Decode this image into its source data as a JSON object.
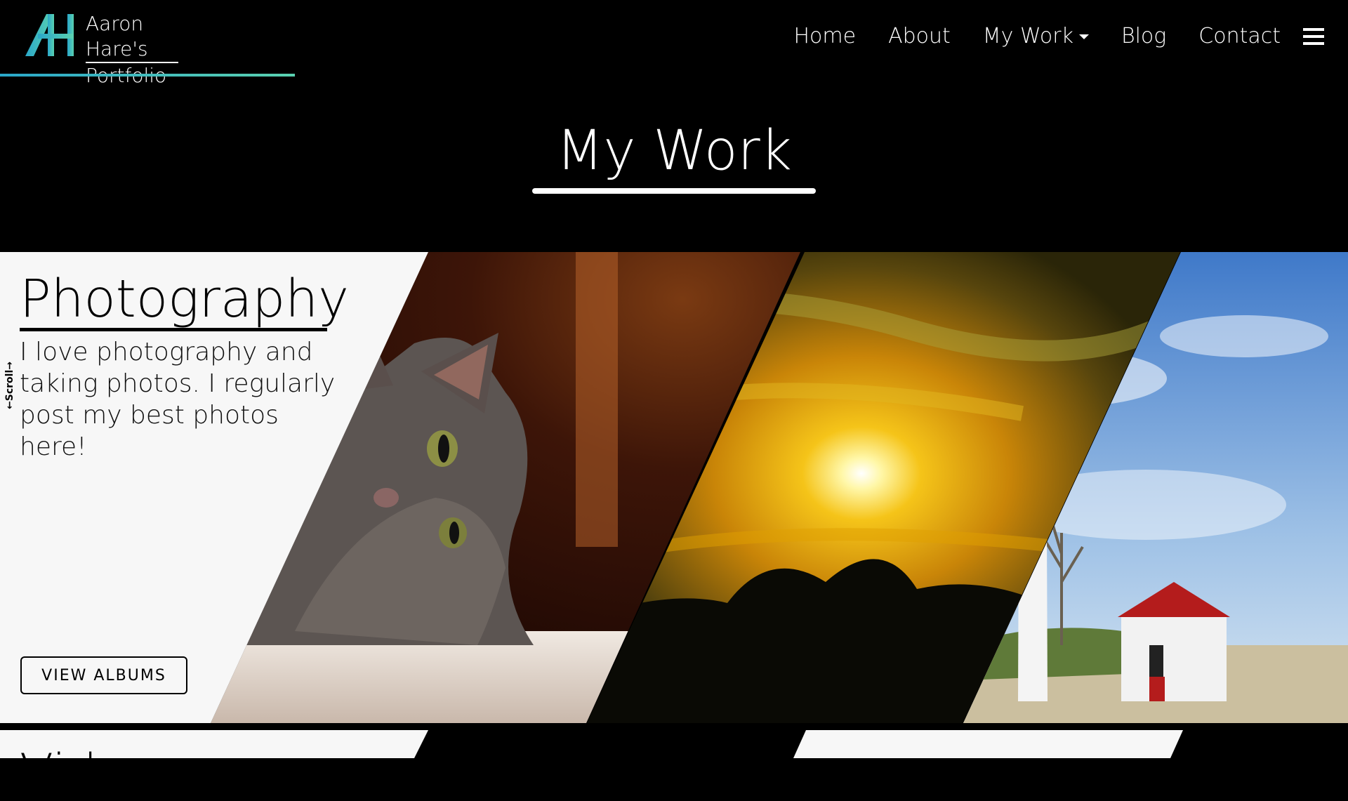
{
  "brand": {
    "line1": "Aaron Hare's",
    "line2": "Portfolio",
    "logo_mark": "AH"
  },
  "nav": {
    "items": [
      {
        "label": "Home"
      },
      {
        "label": "About"
      },
      {
        "label": "My Work",
        "has_dropdown": true
      },
      {
        "label": "Blog"
      },
      {
        "label": "Contact"
      }
    ],
    "menu_icon": "hamburger-menu-icon"
  },
  "page": {
    "title": "My Work"
  },
  "section": {
    "title": "Photography",
    "description": "I love photography and taking photos. I regularly post my best photos here!",
    "scroll_hint": "←Scroll→",
    "button_label": "VIEW ALBUMS",
    "photos": [
      "cat",
      "sunset",
      "lighthouse"
    ]
  },
  "next_section": {
    "title_partial": "Vide"
  },
  "colors": {
    "accent_start": "#2aa7c9",
    "accent_end": "#5ad1b0",
    "background": "#000000",
    "panel": "#f7f7f7"
  }
}
